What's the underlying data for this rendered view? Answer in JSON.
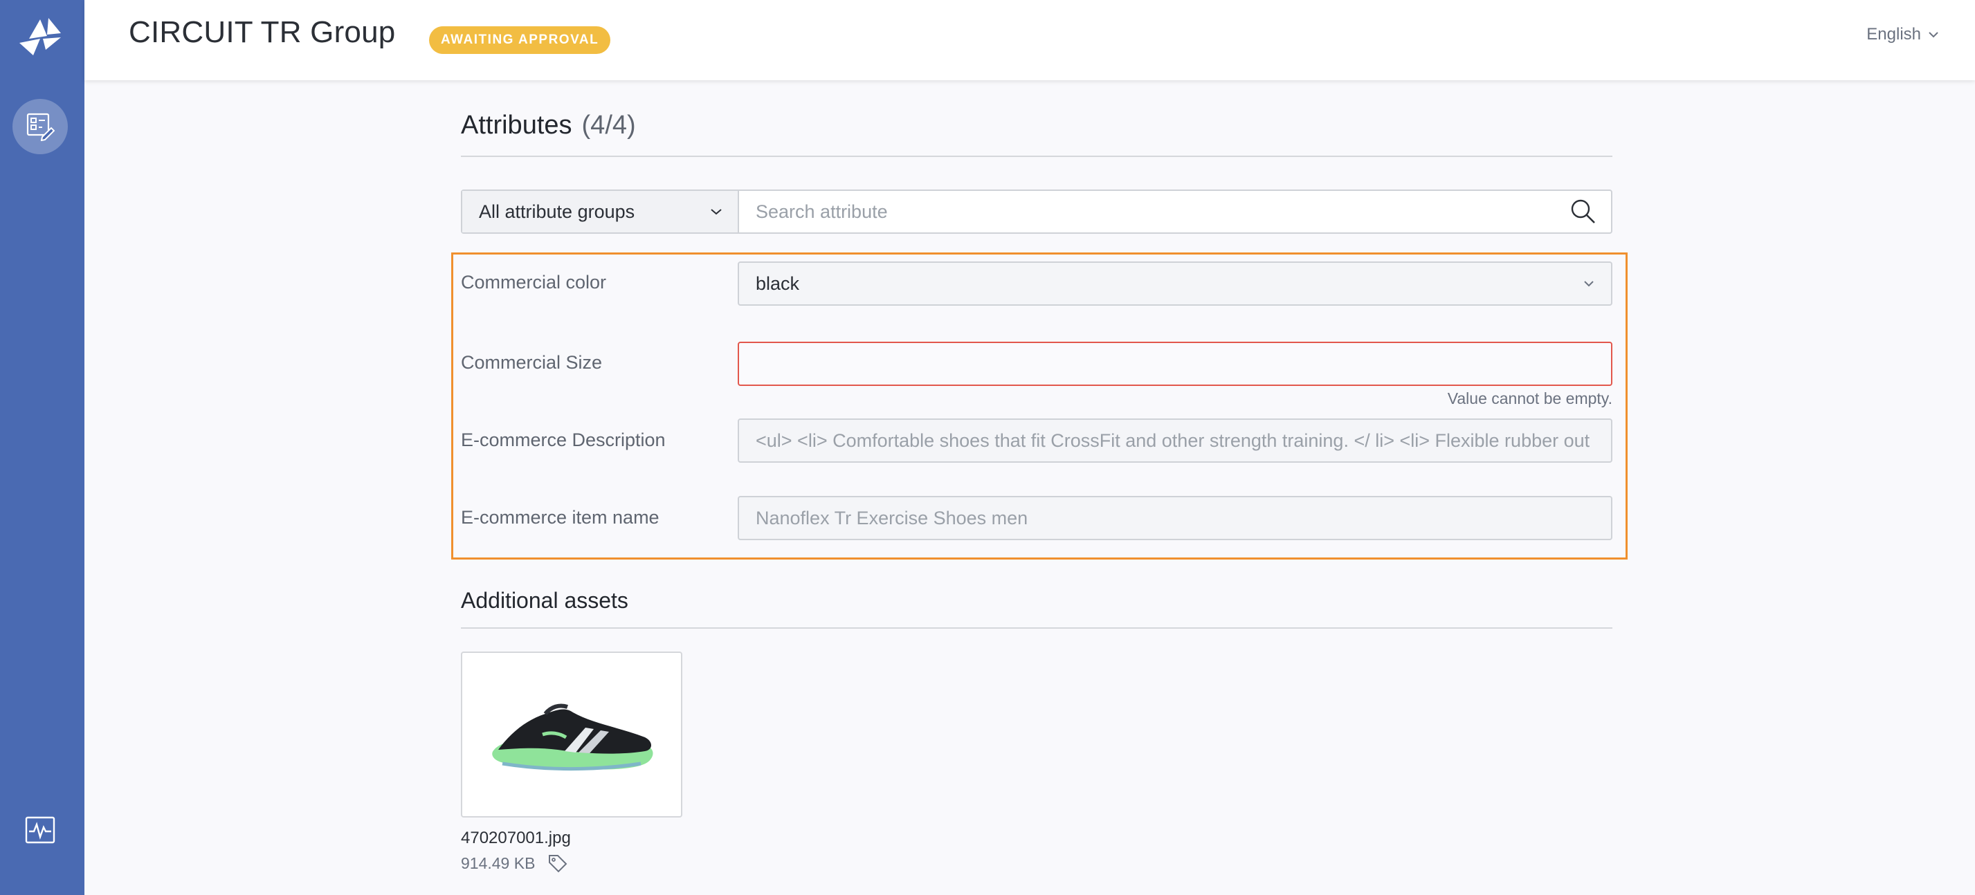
{
  "header": {
    "title": "CIRCUIT TR Group",
    "status_badge": "AWAITING APPROVAL",
    "language": "English"
  },
  "attributes": {
    "title": "Attributes",
    "count": "(4/4)",
    "group_filter": "All attribute groups",
    "search_placeholder": "Search attribute",
    "items": [
      {
        "label": "Commercial color",
        "value": "black"
      },
      {
        "label": "Commercial Size",
        "value": "",
        "error": "Value cannot be empty."
      },
      {
        "label": "E-commerce Description",
        "value": "<ul> <li> Comfortable shoes that fit CrossFit and other strength training. </ li> <li> Flexible rubber out"
      },
      {
        "label": "E-commerce item name",
        "value": "Nanoflex Tr Exercise Shoes men"
      }
    ]
  },
  "assets": {
    "title": "Additional assets",
    "items": [
      {
        "filename": "470207001.jpg",
        "size": "914.49 KB"
      }
    ]
  },
  "colors": {
    "sidebar": "#4a6ab2",
    "badge": "#f2bd42",
    "highlight_frame": "#f0902e",
    "error_border": "#e2574c"
  }
}
